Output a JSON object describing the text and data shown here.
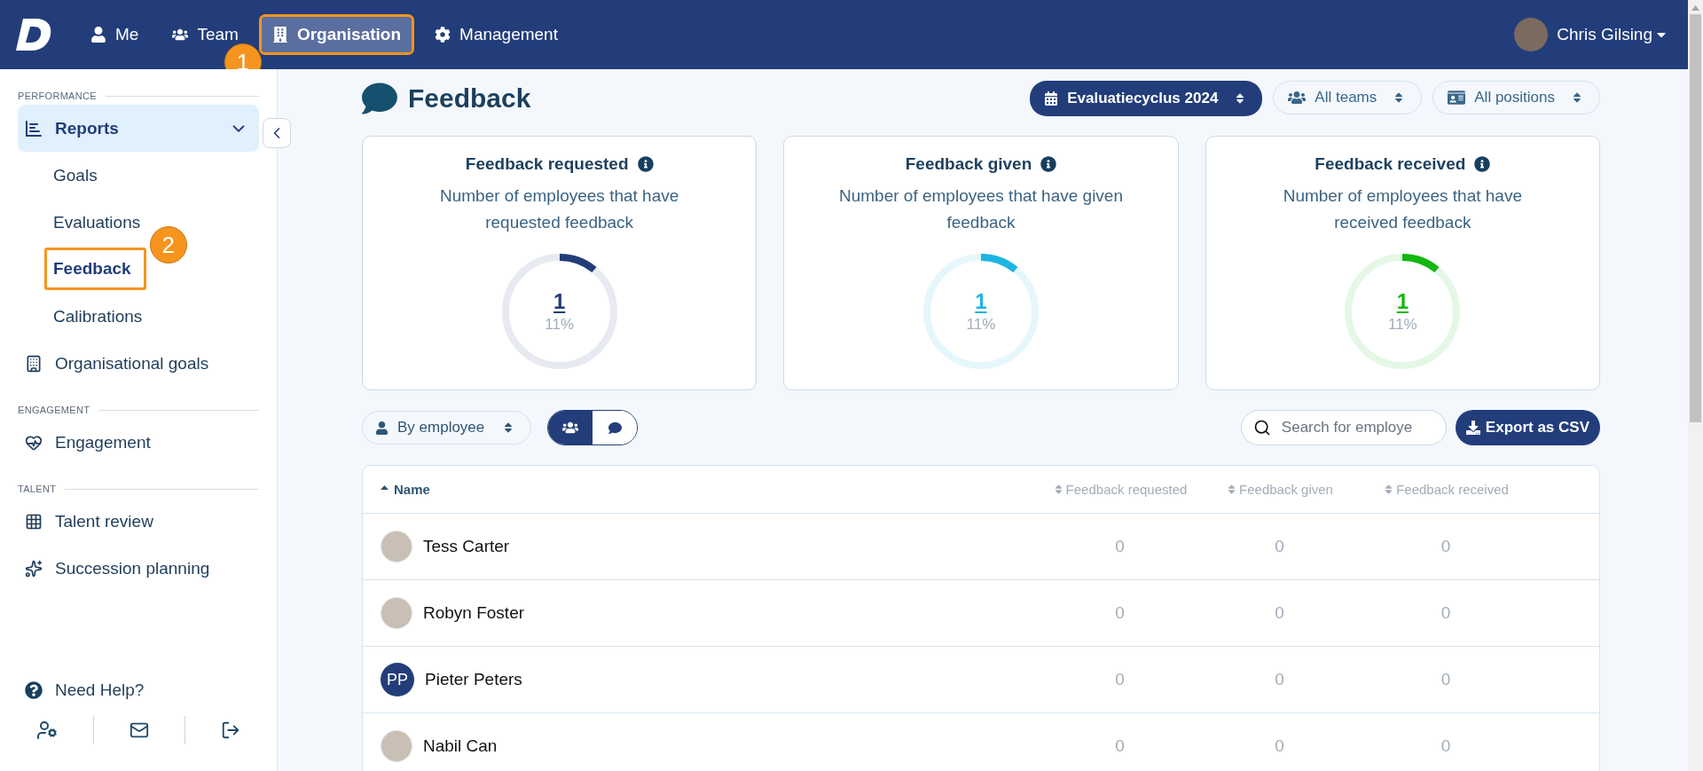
{
  "topbar": {
    "nav": [
      {
        "label": "Me",
        "selected": false
      },
      {
        "label": "Team",
        "selected": false
      },
      {
        "label": "Organisation",
        "selected": true,
        "callout": "1"
      },
      {
        "label": "Management",
        "selected": false
      }
    ],
    "user": {
      "name": "Chris Gilsing"
    }
  },
  "sidebar": {
    "sections": [
      {
        "label": "PERFORMANCE",
        "items": [
          {
            "label": "Reports",
            "selected": true,
            "expanded": true,
            "children": [
              {
                "label": "Goals",
                "selected": false
              },
              {
                "label": "Evaluations",
                "selected": false
              },
              {
                "label": "Feedback",
                "selected": true,
                "callout": "2"
              },
              {
                "label": "Calibrations",
                "selected": false
              }
            ]
          },
          {
            "label": "Organisational goals",
            "selected": false
          }
        ]
      },
      {
        "label": "ENGAGEMENT",
        "items": [
          {
            "label": "Engagement",
            "selected": false
          }
        ]
      },
      {
        "label": "TALENT",
        "items": [
          {
            "label": "Talent review",
            "selected": false
          },
          {
            "label": "Succession planning",
            "selected": false
          }
        ]
      }
    ],
    "help": "Need Help?"
  },
  "page": {
    "title": "Feedback",
    "filters": [
      {
        "label": "Evaluatiecyclus 2024",
        "kind": "primary"
      },
      {
        "label": "All teams",
        "kind": "outline"
      },
      {
        "label": "All positions",
        "kind": "outline"
      }
    ]
  },
  "cards": [
    {
      "title": "Feedback requested",
      "description": "Number of employees that have requested feedback",
      "value": "1",
      "percent": "11%",
      "level": 0.11,
      "color": "#223d7a"
    },
    {
      "title": "Feedback given",
      "description": "Number of employees that have given feedback",
      "value": "1",
      "percent": "11%",
      "level": 0.11,
      "color": "#1db4e2"
    },
    {
      "title": "Feedback received",
      "description": "Number of employees that have received feedback",
      "value": "1",
      "percent": "11%",
      "level": 0.11,
      "color": "#12b80f"
    }
  ],
  "toolbar": {
    "group_by": "By employee",
    "view_toggle": [
      {
        "selected": true
      },
      {
        "selected": false
      }
    ],
    "search": {
      "placeholder": "Search for employe"
    },
    "export": "Export as CSV"
  },
  "table": {
    "columns": [
      {
        "label": "Name",
        "sorted": true
      },
      {
        "label": "Feedback requested",
        "sorted": false
      },
      {
        "label": "Feedback given",
        "sorted": false
      },
      {
        "label": "Feedback received",
        "sorted": false
      }
    ],
    "rows": [
      {
        "avatar": {
          "kind": "photo"
        },
        "cells": [
          "Tess Carter",
          "0",
          "0",
          "0"
        ]
      },
      {
        "avatar": {
          "kind": "photo"
        },
        "cells": [
          "Robyn Foster",
          "0",
          "0",
          "0"
        ]
      },
      {
        "avatar": {
          "kind": "initials",
          "text": "PP"
        },
        "cells": [
          "Pieter Peters",
          "0",
          "0",
          "0"
        ]
      },
      {
        "avatar": {
          "kind": "photo"
        },
        "cells": [
          "Nabil Can",
          "0",
          "0",
          "0"
        ]
      }
    ]
  }
}
